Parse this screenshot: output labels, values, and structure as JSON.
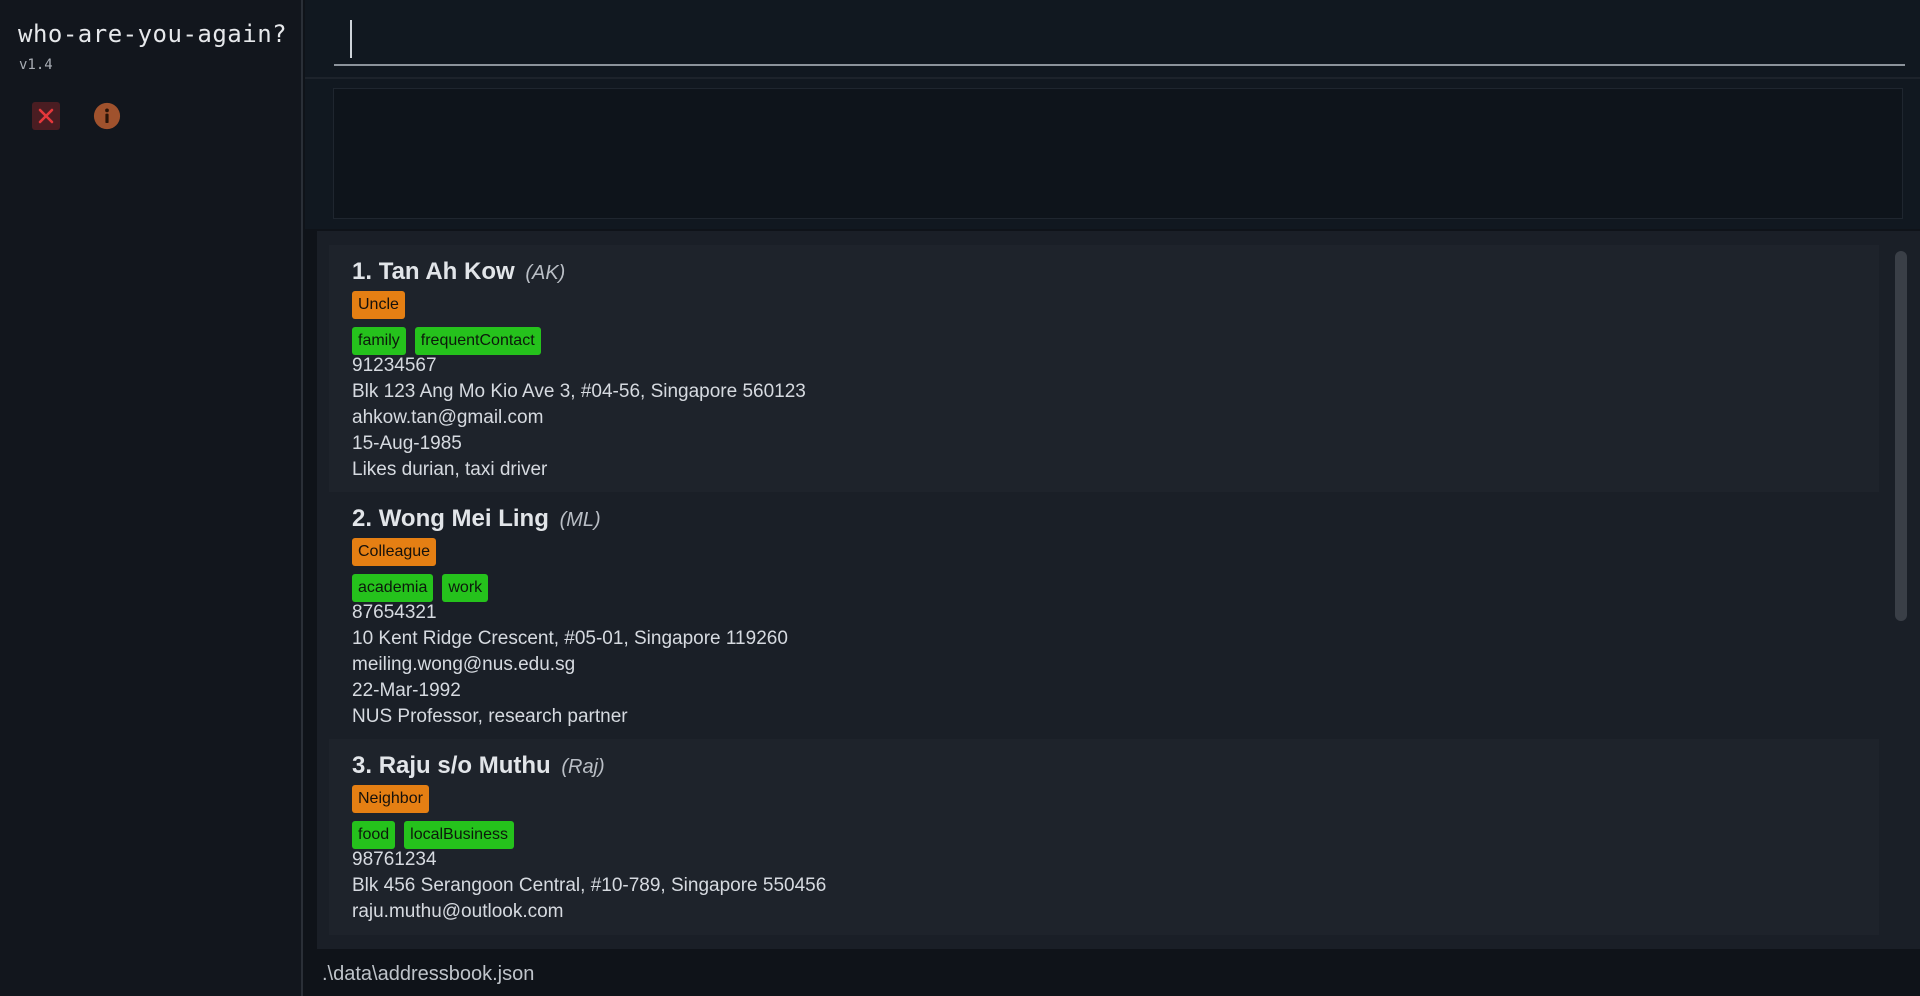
{
  "app": {
    "title": "who-are-you-again?",
    "version": "v1.4"
  },
  "sidebar": {
    "buttons": [
      {
        "icon": "close-icon",
        "color": "#e5383b"
      },
      {
        "icon": "info-icon",
        "color": "#a0522d"
      }
    ]
  },
  "command": {
    "value": "",
    "placeholder": ""
  },
  "result": {
    "text": ""
  },
  "persons": [
    {
      "index": "1.",
      "name": "Tan Ah Kow",
      "nickname": "(AK)",
      "relationship": "Uncle",
      "tags": [
        "family",
        "frequentContact"
      ],
      "phone": "91234567",
      "address": "Blk 123 Ang Mo Kio Ave 3, #04-56, Singapore 560123",
      "email": "ahkow.tan@gmail.com",
      "birthday": "15-Aug-1985",
      "notes": "Likes durian, taxi driver"
    },
    {
      "index": "2.",
      "name": "Wong Mei Ling",
      "nickname": "(ML)",
      "relationship": "Colleague",
      "tags": [
        "academia",
        "work"
      ],
      "phone": "87654321",
      "address": "10 Kent Ridge Crescent, #05-01, Singapore 119260",
      "email": "meiling.wong@nus.edu.sg",
      "birthday": "22-Mar-1992",
      "notes": "NUS Professor, research partner"
    },
    {
      "index": "3.",
      "name": "Raju s/o Muthu",
      "nickname": "(Raj)",
      "relationship": "Neighbor",
      "tags": [
        "food",
        "localBusiness"
      ],
      "phone": "98761234",
      "address": "Blk 456 Serangoon Central, #10-789, Singapore 550456",
      "email": "raju.muthu@outlook.com"
    }
  ],
  "status": {
    "path": ".\\data\\addressbook.json"
  },
  "colors": {
    "relationship_tag": "#e57f13",
    "tag": "#25c21c",
    "background": "#0f1319"
  }
}
